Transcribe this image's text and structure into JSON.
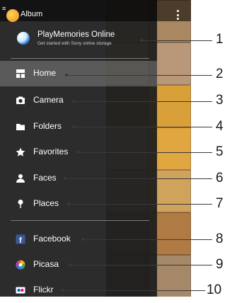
{
  "header": {
    "app_title": "Album"
  },
  "playmemories": {
    "title": "PlayMemories Online",
    "subtitle": "Get started with Sony online storage"
  },
  "nav": {
    "items": [
      {
        "label": "Home",
        "icon": "home-icon",
        "selected": true
      },
      {
        "label": "Camera",
        "icon": "camera-icon"
      },
      {
        "label": "Folders",
        "icon": "folder-icon"
      },
      {
        "label": "Favorites",
        "icon": "star-icon"
      },
      {
        "label": "Faces",
        "icon": "person-icon"
      },
      {
        "label": "Places",
        "icon": "location-pin-icon"
      }
    ],
    "services": [
      {
        "label": "Facebook",
        "icon": "facebook-icon",
        "color": "#3b5998"
      },
      {
        "label": "Picasa",
        "icon": "picasa-icon"
      },
      {
        "label": "Flickr",
        "icon": "flickr-icon",
        "color": "#0063dc"
      }
    ]
  },
  "callouts": [
    "1",
    "2",
    "3",
    "4",
    "5",
    "6",
    "7",
    "8",
    "9",
    "10"
  ]
}
